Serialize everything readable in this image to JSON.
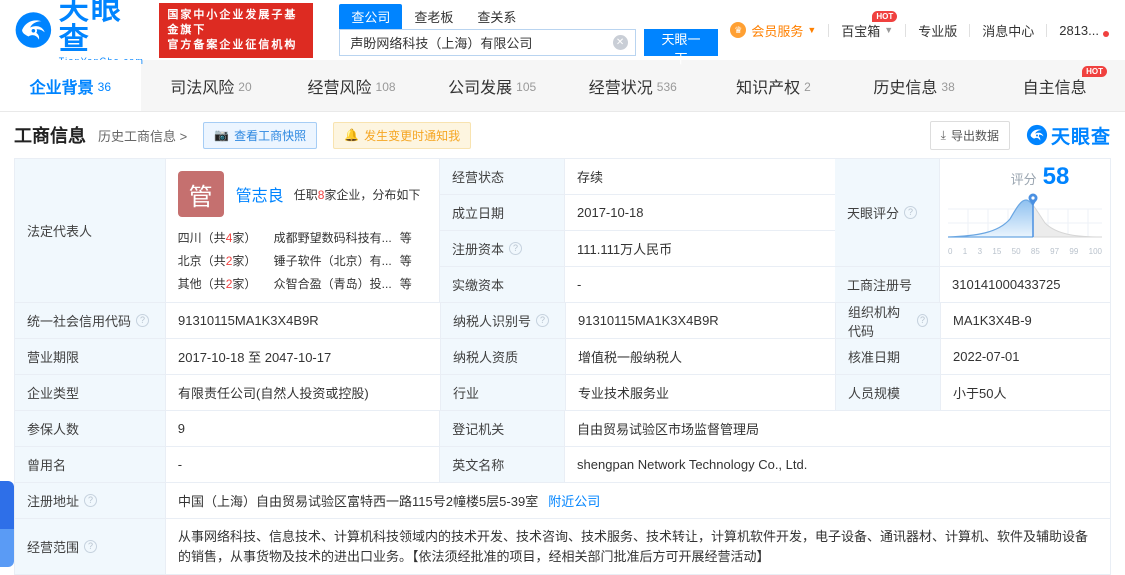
{
  "header": {
    "logo": {
      "title": "天眼查",
      "domain": "TianYanCha.com"
    },
    "gov_badge": {
      "line1": "国家中小企业发展子基金旗下",
      "line2": "官方备案企业征信机构"
    },
    "search": {
      "tabs": [
        {
          "label": "查公司"
        },
        {
          "label": "查老板"
        },
        {
          "label": "查关系"
        }
      ],
      "value": "声盼网络科技（上海）有限公司",
      "button": "天眼一下"
    },
    "nav": {
      "vip": "会员服务",
      "toolbox": "百宝箱",
      "toolbox_badge": "HOT",
      "pro": "专业版",
      "messages": "消息中心",
      "account": "2813..."
    }
  },
  "tabs": [
    {
      "label": "企业背景",
      "count": "36"
    },
    {
      "label": "司法风险",
      "count": "20"
    },
    {
      "label": "经营风险",
      "count": "108"
    },
    {
      "label": "公司发展",
      "count": "105"
    },
    {
      "label": "经营状况",
      "count": "536"
    },
    {
      "label": "知识产权",
      "count": "2"
    },
    {
      "label": "历史信息",
      "count": "38"
    },
    {
      "label": "自主信息",
      "count": "",
      "badge": "HOT"
    }
  ],
  "section": {
    "title": "工商信息",
    "history_link": "历史工商信息 >",
    "snapshot_button": "查看工商快照",
    "notify_button": "发生变更时通知我",
    "export_button": "导出数据",
    "watermark": "天眼查"
  },
  "legal_rep": {
    "label": "法定代表人",
    "avatar_char": "管",
    "name": "管志良",
    "note_pre": "任职",
    "note_num": "8",
    "note_post": "家企业，分布如下",
    "regions": [
      {
        "pre": "四川（共",
        "num": "4",
        "post": "家）",
        "company": "成都野望数码科技有...",
        "etc": "等"
      },
      {
        "pre": "北京（共",
        "num": "2",
        "post": "家）",
        "company": "锤子软件（北京）有...",
        "etc": "等"
      },
      {
        "pre": "其他（共",
        "num": "2",
        "post": "家）",
        "company": "众智合盈（青岛）投...",
        "etc": "等"
      }
    ]
  },
  "fields": {
    "status": {
      "label": "经营状态",
      "value": "存续"
    },
    "est_date": {
      "label": "成立日期",
      "value": "2017-10-18"
    },
    "reg_capital": {
      "label": "注册资本",
      "value": "111.111万人民币"
    },
    "paid_capital": {
      "label": "实缴资本",
      "value": "-"
    },
    "reg_number": {
      "label": "工商注册号",
      "value": "310141000433725"
    },
    "credit_code": {
      "label": "统一社会信用代码",
      "value": "91310115MA1K3X4B9R"
    },
    "taxpayer_id": {
      "label": "纳税人识别号",
      "value": "91310115MA1K3X4B9R"
    },
    "org_code": {
      "label": "组织机构代码",
      "value": "MA1K3X4B-9"
    },
    "business_term": {
      "label": "营业期限",
      "value": "2017-10-18 至 2047-10-17"
    },
    "taxpayer_quality": {
      "label": "纳税人资质",
      "value": "增值税一般纳税人"
    },
    "approval_date": {
      "label": "核准日期",
      "value": "2022-07-01"
    },
    "company_type": {
      "label": "企业类型",
      "value": "有限责任公司(自然人投资或控股)"
    },
    "industry": {
      "label": "行业",
      "value": "专业技术服务业"
    },
    "staff_size": {
      "label": "人员规模",
      "value": "小于50人"
    },
    "insured_count": {
      "label": "参保人数",
      "value": "9"
    },
    "reg_authority": {
      "label": "登记机关",
      "value": "自由贸易试验区市场监督管理局"
    },
    "former_name": {
      "label": "曾用名",
      "value": "-"
    },
    "english_name": {
      "label": "英文名称",
      "value": "shengpan Network Technology Co., Ltd."
    },
    "address": {
      "label": "注册地址",
      "value": "中国（上海）自由贸易试验区富特西一路115号2幢楼5层5-39室",
      "link": "附近公司"
    },
    "business_scope": {
      "label": "经营范围",
      "value": "从事网络科技、信息技术、计算机科技领域内的技术开发、技术咨询、技术服务、技术转让，计算机软件开发，电子设备、通讯器材、计算机、软件及辅助设备的销售，从事货物及技术的进出口业务。【依法须经批准的项目，经相关部门批准后方可开展经营活动】"
    }
  },
  "score": {
    "label": "天眼评分",
    "word": "评分",
    "value": "58",
    "axis": [
      "0",
      "1",
      "3",
      "15",
      "50",
      "85",
      "97",
      "99",
      "100"
    ]
  },
  "colors": {
    "brand_blue": "#0084ff",
    "badge_red": "#dd2b22",
    "hot_red": "#f0413f",
    "vip_orange": "#ff8000",
    "label_bg": "#f1f8fd"
  }
}
